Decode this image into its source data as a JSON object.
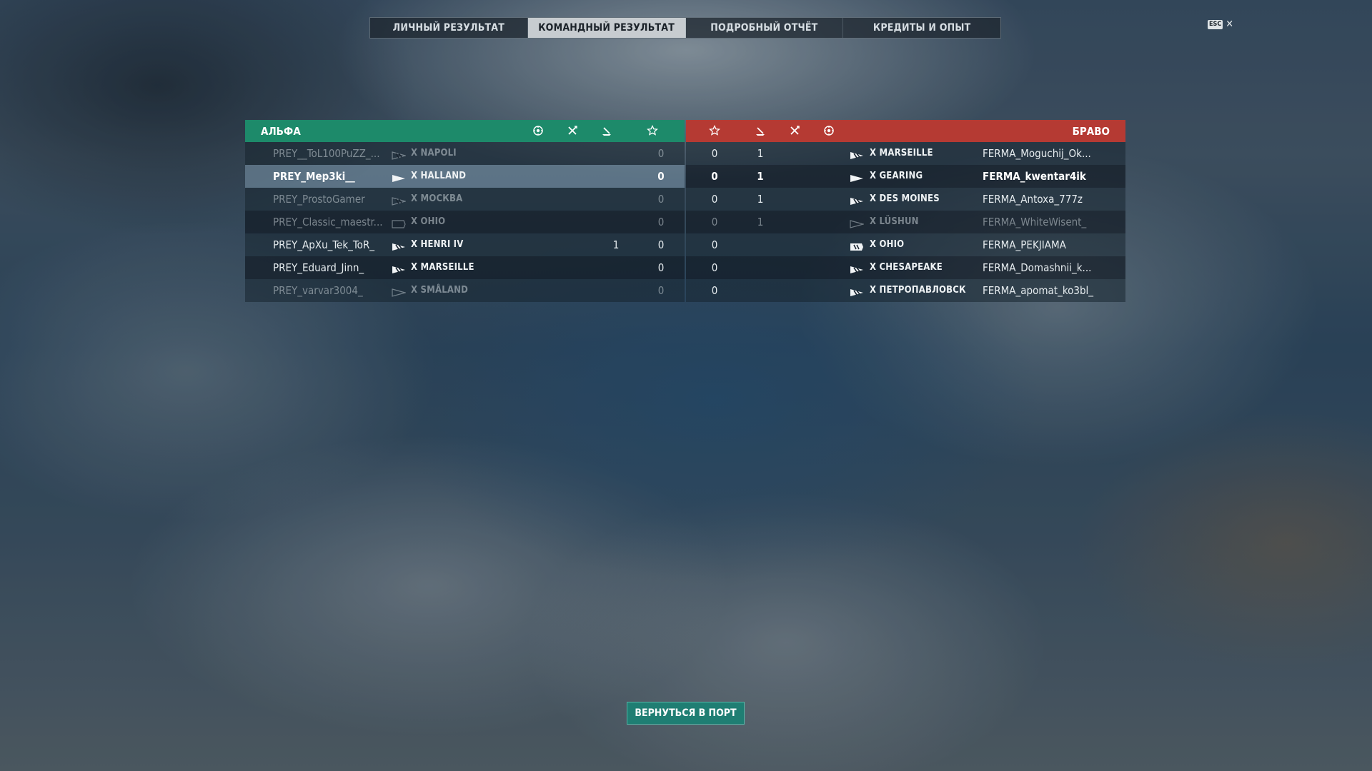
{
  "tabs": [
    {
      "label": "ЛИЧНЫЙ РЕЗУЛЬТАТ",
      "active": false
    },
    {
      "label": "КОМАНДНЫЙ РЕЗУЛЬТАТ",
      "active": true
    },
    {
      "label": "ПОДРОБНЫЙ ОТЧЁТ",
      "active": false
    },
    {
      "label": "КРЕДИТЫ И ОПЫТ",
      "active": false
    }
  ],
  "close": {
    "key_label": "ESC",
    "glyph": "✕"
  },
  "teams": {
    "alpha": {
      "name": "АЛЬФА",
      "color": "#1d8a6a",
      "column_icons": [
        "base-capture-icon",
        "aircraft-kills-icon",
        "ship-kills-icon",
        "xp-star-icon"
      ],
      "players": [
        {
          "name": "PREY__ToL100PuZZ_...",
          "ship": "X NAPOLI",
          "class_icon": "cruiser-icon",
          "aircraft": "",
          "ships": "",
          "xp": "0",
          "state": "dim"
        },
        {
          "name": "PREY_Mep3ki__",
          "ship": "X HALLAND",
          "class_icon": "destroyer-icon",
          "aircraft": "",
          "ships": "",
          "xp": "0",
          "state": "me"
        },
        {
          "name": "PREY_ProstoGamer",
          "ship": "X МОСКВА",
          "class_icon": "cruiser-icon",
          "aircraft": "",
          "ships": "",
          "xp": "0",
          "state": "dim"
        },
        {
          "name": "PREY_Classic_maestr...",
          "ship": "X OHIO",
          "class_icon": "battleship-icon",
          "aircraft": "",
          "ships": "",
          "xp": "0",
          "state": "dim"
        },
        {
          "name": "PREY_ApXu_Tek_ToR_",
          "ship": "X HENRI IV",
          "class_icon": "cruiser-icon",
          "aircraft": "",
          "ships": "1",
          "xp": "0",
          "state": "alive"
        },
        {
          "name": "PREY_Eduard_Jinn_",
          "ship": "X MARSEILLE",
          "class_icon": "cruiser-icon",
          "aircraft": "",
          "ships": "",
          "xp": "0",
          "state": "alive"
        },
        {
          "name": "PREY_varvar3004_",
          "ship": "X SMÅLAND",
          "class_icon": "destroyer-icon",
          "aircraft": "",
          "ships": "",
          "xp": "0",
          "state": "dim"
        }
      ]
    },
    "bravo": {
      "name": "БРАВО",
      "color": "#b53a33",
      "column_icons": [
        "xp-star-icon",
        "ship-kills-icon",
        "aircraft-kills-icon",
        "base-capture-icon"
      ],
      "players": [
        {
          "name": "FERMA_Moguchij_Ok...",
          "ship": "X MARSEILLE",
          "class_icon": "cruiser-icon",
          "xp": "0",
          "ships": "1",
          "aircraft": "",
          "state": "alive"
        },
        {
          "name": "FERMA_kwentar4ik",
          "ship": "X GEARING",
          "class_icon": "destroyer-icon",
          "xp": "0",
          "ships": "1",
          "aircraft": "",
          "state": "alive"
        },
        {
          "name": "FERMA_Antoxa_777z",
          "ship": "X DES MOINES",
          "class_icon": "cruiser-icon",
          "xp": "0",
          "ships": "1",
          "aircraft": "",
          "state": "alive"
        },
        {
          "name": "FERMA_WhiteWisent_",
          "ship": "X LÜSHUN",
          "class_icon": "destroyer-icon",
          "xp": "0",
          "ships": "1",
          "aircraft": "",
          "state": "dim"
        },
        {
          "name": "FERMA_PEKJIAMA",
          "ship": "X OHIO",
          "class_icon": "battleship-icon",
          "xp": "0",
          "ships": "",
          "aircraft": "",
          "state": "alive"
        },
        {
          "name": "FERMA_Domashnii_k...",
          "ship": "X CHESAPEAKE",
          "class_icon": "cruiser-icon",
          "xp": "0",
          "ships": "",
          "aircraft": "",
          "state": "alive"
        },
        {
          "name": "FERMA_apomat_ko3bl_",
          "ship": "X ПЕТРОПАВЛОВСК",
          "class_icon": "cruiser-icon",
          "xp": "0",
          "ships": "",
          "aircraft": "",
          "state": "alive"
        }
      ]
    }
  },
  "return_button": {
    "label": "ВЕРНУТЬСЯ В ПОРТ"
  }
}
